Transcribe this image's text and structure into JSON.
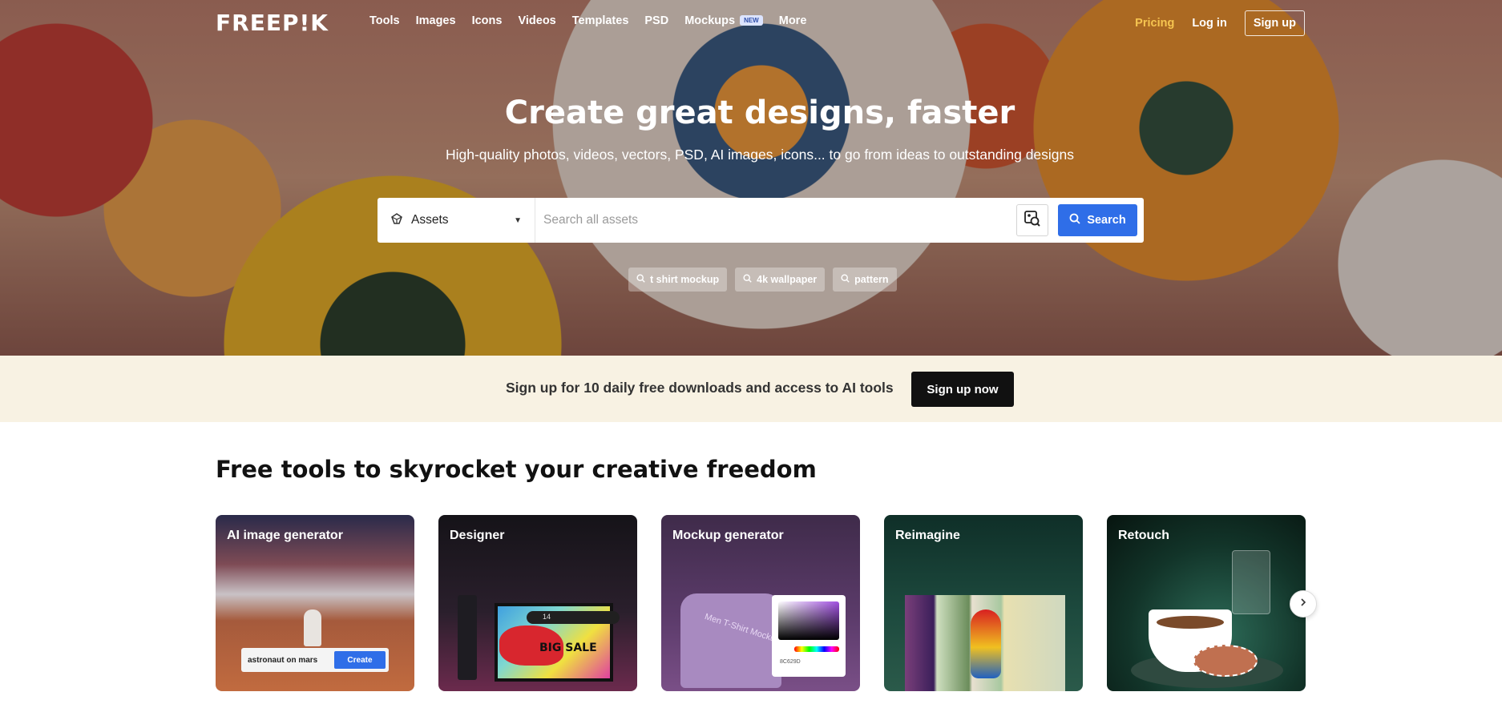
{
  "brand": {
    "logo": "FREEP!K"
  },
  "nav": {
    "links": [
      "Tools",
      "Images",
      "Icons",
      "Videos",
      "Templates",
      "PSD",
      "Mockups",
      "More"
    ],
    "mockups_badge": "NEW",
    "pricing": "Pricing",
    "login": "Log in",
    "signup": "Sign up"
  },
  "hero": {
    "title": "Create great designs, faster",
    "subtitle": "High-quality photos, videos, vectors, PSD, AI images, icons... to go from ideas to outstanding designs"
  },
  "search": {
    "category": "Assets",
    "placeholder": "Search all assets",
    "value": "",
    "button": "Search"
  },
  "suggestions": [
    "t shirt mockup",
    "4k wallpaper",
    "pattern"
  ],
  "promo": {
    "text": "Sign up for 10 daily free downloads and access to AI tools",
    "button": "Sign up now"
  },
  "tools": {
    "title": "Free tools to skyrocket your creative freedom",
    "cards": [
      {
        "label": "AI image generator",
        "prompt": "astronaut on mars",
        "button": "Create"
      },
      {
        "label": "Designer",
        "font_size": "14",
        "sale_text": "BIG SALE"
      },
      {
        "label": "Mockup generator",
        "shirt_text": "Men T-Shirt Mockup",
        "hex": "8C629D"
      },
      {
        "label": "Reimagine"
      },
      {
        "label": "Retouch"
      }
    ]
  },
  "colors": {
    "accent_blue": "#2f6ee8",
    "pricing_yellow": "#f6c550",
    "promo_bg": "#f8f2e3",
    "dark": "#111111"
  },
  "icons": {
    "search": "search-icon",
    "assets": "assets-icon",
    "caret": "caret-down-icon",
    "image_search": "image-search-icon",
    "next": "chevron-right-icon"
  }
}
